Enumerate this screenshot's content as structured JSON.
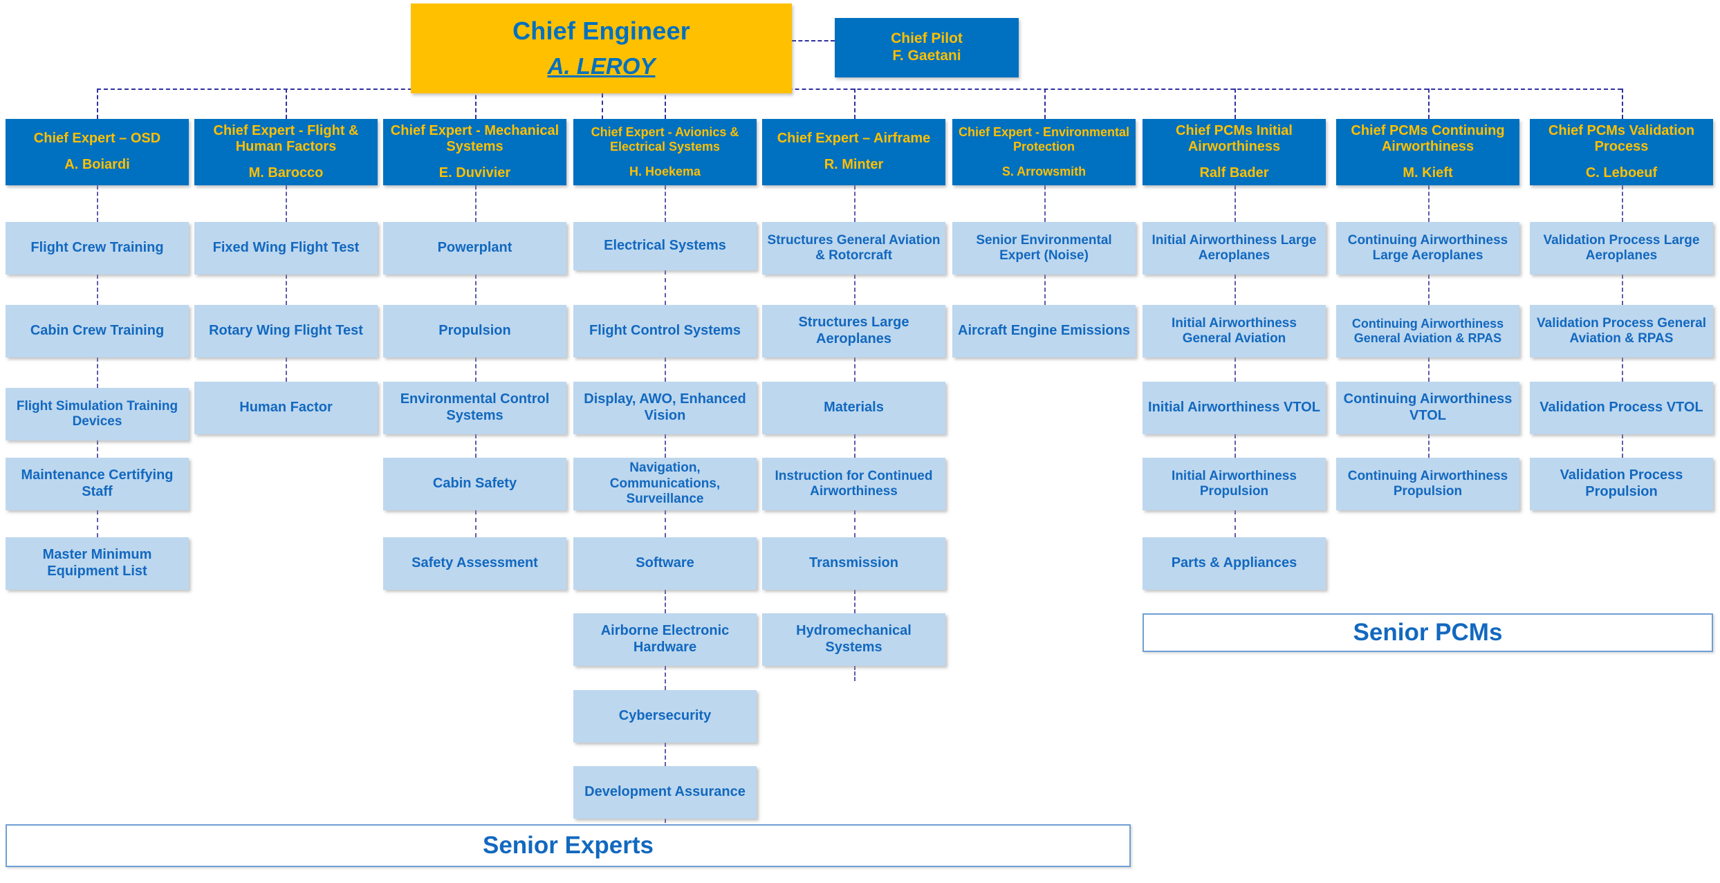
{
  "theme": {
    "root_fill": "#FFC000",
    "root_text": "#0070C0",
    "header_fill": "#0070C0",
    "header_text": "#FFC000",
    "leaf_fill": "#BDD7EE",
    "leaf_text": "#1268BF",
    "connector": "#2F2FA0",
    "banner_border": "#6E9FD4"
  },
  "root": {
    "title": "Chief Engineer",
    "name": "A. LEROY"
  },
  "peer": {
    "title": "Chief Pilot",
    "name": "F. Gaetani"
  },
  "columns": [
    {
      "header": {
        "role": "Chief Expert – OSD",
        "name": "A. Boiardi"
      },
      "leaves": [
        "Flight Crew Training",
        "Cabin Crew Training",
        "Flight Simulation Training Devices",
        "Maintenance Certifying Staff",
        "Master Minimum Equipment List"
      ]
    },
    {
      "header": {
        "role": "Chief Expert - Flight & Human Factors",
        "name": "M. Barocco"
      },
      "leaves": [
        "Fixed Wing Flight Test",
        "Rotary Wing Flight Test",
        "Human Factor"
      ]
    },
    {
      "header": {
        "role": "Chief Expert - Mechanical Systems",
        "name": "E. Duvivier"
      },
      "leaves": [
        "Powerplant",
        "Propulsion",
        "Environmental Control Systems",
        "Cabin Safety",
        "Safety Assessment"
      ]
    },
    {
      "header": {
        "role": "Chief Expert - Avionics & Electrical Systems",
        "name": "H. Hoekema"
      },
      "leaves": [
        "Electrical Systems",
        "Flight Control Systems",
        "Display, AWO, Enhanced Vision",
        "Navigation, Communications, Surveillance",
        "Software",
        "Airborne Electronic Hardware",
        "Cybersecurity",
        "Development Assurance"
      ]
    },
    {
      "header": {
        "role": "Chief Expert – Airframe",
        "name": "R. Minter"
      },
      "leaves": [
        "Structures General Aviation & Rotorcraft",
        "Structures Large Aeroplanes",
        "Materials",
        "Instruction for Continued Airworthiness",
        "Transmission",
        "Hydromechanical Systems"
      ]
    },
    {
      "header": {
        "role": "Chief Expert - Environmental Protection",
        "name": "S. Arrowsmith"
      },
      "leaves": [
        "Senior Environmental Expert (Noise)",
        "Aircraft Engine Emissions"
      ]
    },
    {
      "header": {
        "role": "Chief PCMs Initial Airworthiness",
        "name": "Ralf Bader"
      },
      "leaves": [
        "Initial Airworthiness Large Aeroplanes",
        "Initial Airworthiness General Aviation",
        "Initial Airworthiness VTOL",
        "Initial Airworthiness Propulsion",
        "Parts & Appliances"
      ]
    },
    {
      "header": {
        "role": "Chief PCMs Continuing Airworthiness",
        "name": "M. Kieft"
      },
      "leaves": [
        "Continuing Airworthiness Large Aeroplanes",
        "Continuing Airworthiness General Aviation & RPAS",
        "Continuing Airworthiness VTOL",
        "Continuing Airworthiness Propulsion"
      ]
    },
    {
      "header": {
        "role": "Chief PCMs Validation Process",
        "name": "C. Leboeuf"
      },
      "leaves": [
        "Validation Process Large Aeroplanes",
        "Validation Process General Aviation & RPAS",
        "Validation Process VTOL",
        "Validation Process Propulsion"
      ]
    }
  ],
  "banners": {
    "senior_pcms": "Senior PCMs",
    "senior_experts": "Senior Experts"
  }
}
